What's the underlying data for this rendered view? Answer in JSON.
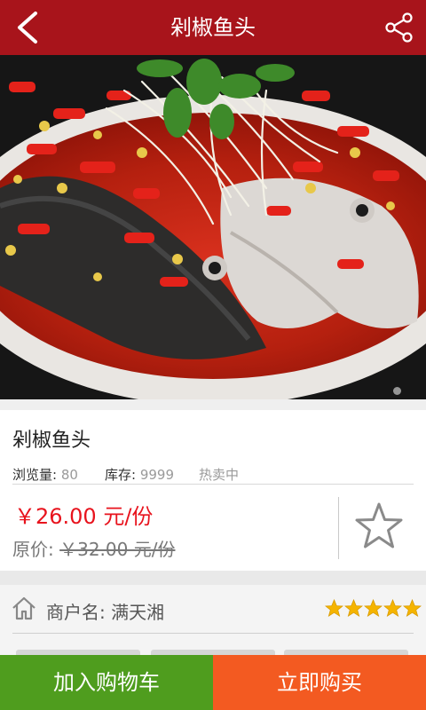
{
  "header": {
    "title": "剁椒鱼头",
    "back_icon": "chevron-left-icon",
    "share_icon": "share-icon"
  },
  "product": {
    "name": "剁椒鱼头",
    "views_label": "浏览量:",
    "views_value": "80",
    "stock_label": "库存:",
    "stock_value": "9999",
    "status": "热卖中",
    "price": "￥26.00 元/份",
    "original_label": "原价:",
    "original_price": "￥32.00 元/份",
    "rating": 5
  },
  "merchant": {
    "label": "商户名:",
    "name": "满天湘"
  },
  "actions": {
    "add_to_cart": "加入购物车",
    "buy_now": "立即购买"
  },
  "colors": {
    "header": "#a8141b",
    "price": "#e8131d",
    "cart": "#4f9d1e",
    "buy": "#f35a21",
    "star": "#f5b400"
  }
}
